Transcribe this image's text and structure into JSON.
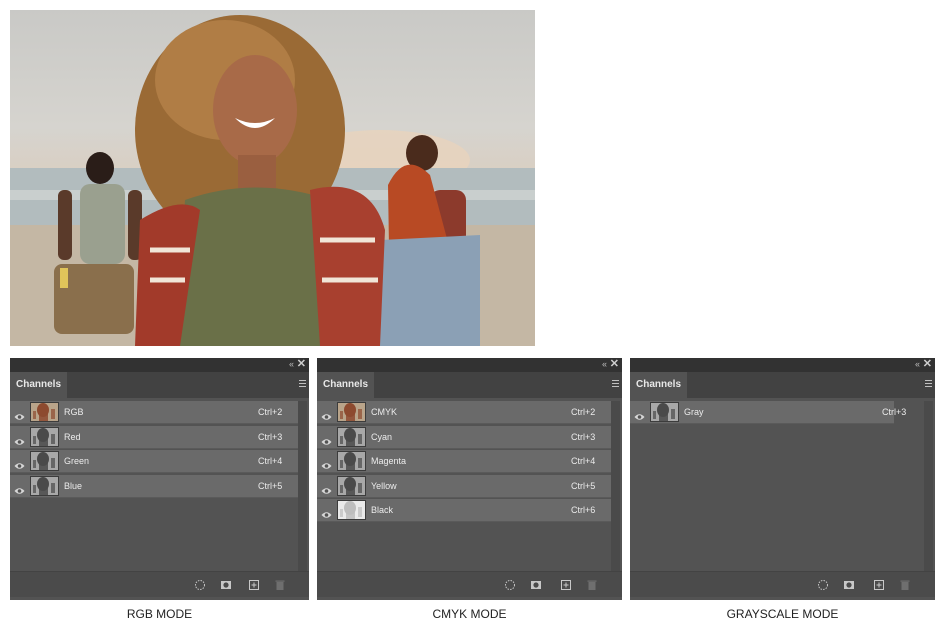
{
  "photo": {
    "alt": "beach-photo"
  },
  "panels": [
    {
      "id": "rgb",
      "tab_label": "Channels",
      "collapse_glyph": "‹‹",
      "close_glyph": "✕",
      "channels": [
        {
          "name": "RGB",
          "shortcut": "Ctrl+2"
        },
        {
          "name": "Red",
          "shortcut": "Ctrl+3"
        },
        {
          "name": "Green",
          "shortcut": "Ctrl+4"
        },
        {
          "name": "Blue",
          "shortcut": "Ctrl+5"
        }
      ],
      "caption": "RGB MODE"
    },
    {
      "id": "cmyk",
      "tab_label": "Channels",
      "collapse_glyph": "‹‹",
      "close_glyph": "✕",
      "channels": [
        {
          "name": "CMYK",
          "shortcut": "Ctrl+2"
        },
        {
          "name": "Cyan",
          "shortcut": "Ctrl+3"
        },
        {
          "name": "Magenta",
          "shortcut": "Ctrl+4"
        },
        {
          "name": "Yellow",
          "shortcut": "Ctrl+5"
        },
        {
          "name": "Black",
          "shortcut": "Ctrl+6"
        }
      ],
      "caption": "CMYK MODE"
    },
    {
      "id": "gray",
      "tab_label": "Channels",
      "collapse_glyph": "‹‹",
      "close_glyph": "✕",
      "channels": [
        {
          "name": "Gray",
          "shortcut": "Ctrl+3"
        }
      ],
      "caption": "GRAYSCALE MODE"
    }
  ],
  "bottom_icons": [
    "load-selection-icon",
    "save-selection-icon",
    "new-channel-icon",
    "trash-icon"
  ],
  "colors": {
    "panel_bg": "#535353",
    "row_bg": "#6a6a6a",
    "topbar": "#323232",
    "tabrow": "#424242"
  }
}
